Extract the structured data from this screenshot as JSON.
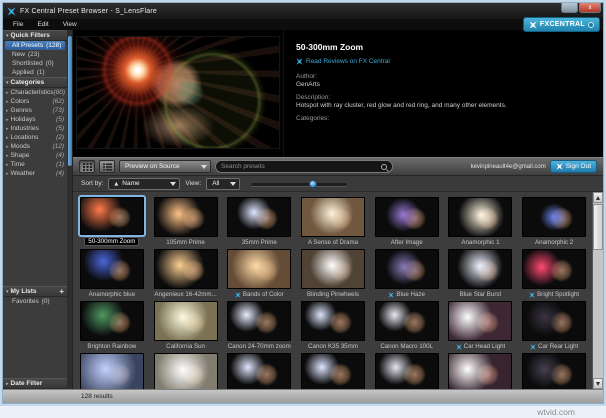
{
  "window": {
    "title": "FX Central Preset Browser - S_LensFlare",
    "menus": [
      "File",
      "Edit",
      "View"
    ]
  },
  "sidebar": {
    "quick_filters": {
      "label": "Quick Filters",
      "items": [
        {
          "label": "All Presets",
          "count": "(128)",
          "selected": true
        },
        {
          "label": "New",
          "count": "(23)"
        },
        {
          "label": "Shortlisted",
          "count": "(0)"
        },
        {
          "label": "Applied",
          "count": "(1)"
        }
      ]
    },
    "categories": {
      "label": "Categories",
      "items": [
        {
          "label": "Characteristics",
          "count": "(80)"
        },
        {
          "label": "Colors",
          "count": "(62)"
        },
        {
          "label": "Genres",
          "count": "(73)"
        },
        {
          "label": "Holidays",
          "count": "(5)"
        },
        {
          "label": "Industries",
          "count": "(5)"
        },
        {
          "label": "Locations",
          "count": "(2)"
        },
        {
          "label": "Moods",
          "count": "(12)"
        },
        {
          "label": "Shape",
          "count": "(4)"
        },
        {
          "label": "Time",
          "count": "(1)"
        },
        {
          "label": "Weather",
          "count": "(4)"
        }
      ]
    },
    "my_lists": {
      "label": "My Lists",
      "add_label": "+",
      "items": [
        {
          "label": "Favorites",
          "count": "(0)"
        }
      ]
    },
    "date_filter": {
      "label": "Date Filter"
    }
  },
  "info_panel": {
    "fx_central_badge": "FXCENTRAL",
    "preset_title": "50-300mm Zoom",
    "review_link": "Read Reviews on FX Central",
    "author_label": "Author:",
    "author": "GenArts",
    "description_label": "Description:",
    "description": "Hotspot with ray cluster, red glow and red ring, and many other elements.",
    "categories_label": "Categories:"
  },
  "toolbar": {
    "preview_dropdown": "Preview on Source",
    "search_placeholder": "Search presets",
    "account_email": "kevinpineault4e@gmail.com",
    "sign_out_label": "Sign Out",
    "sort_by_label": "Sort by:",
    "sort_value": "Name",
    "view_label": "View:",
    "view_value": "All"
  },
  "grid": {
    "presets": [
      {
        "name": "50-300mm Zoom",
        "sel": true,
        "glow": "#ff7a4a",
        "gx": 30,
        "gy": 32,
        "gs": 45,
        "wash": ""
      },
      {
        "name": "105mm Prime",
        "glow": "#ffc387",
        "gx": 38,
        "gy": 42,
        "gs": 50,
        "wash": ""
      },
      {
        "name": "35mm Prime",
        "glow": "#dfe6ff",
        "gx": 42,
        "gy": 38,
        "gs": 40,
        "wash": ""
      },
      {
        "name": "A Sense of Drama",
        "glow": "#fff3dc",
        "gx": 48,
        "gy": 40,
        "gs": 55,
        "wash": "rgba(196,150,104,0.55)"
      },
      {
        "name": "After Image",
        "glow": "#9a7ad6",
        "gx": 44,
        "gy": 44,
        "gs": 42,
        "wash": ""
      },
      {
        "name": "Anamorphic 1",
        "glow": "#fff6e0",
        "gx": 52,
        "gy": 45,
        "gs": 60,
        "wash": ""
      },
      {
        "name": "Anamorphic 2",
        "glow": "#6b85ef",
        "gx": 50,
        "gy": 50,
        "gs": 38,
        "wash": ""
      },
      {
        "name": "Anamorphic blue",
        "glow": "#4a66d8",
        "gx": 36,
        "gy": 30,
        "gs": 42,
        "wash": ""
      },
      {
        "name": "Angenieux 16-42mm...",
        "glow": "#ffd092",
        "gx": 40,
        "gy": 40,
        "gs": 55,
        "wash": ""
      },
      {
        "name": "Bands of Color",
        "badge": true,
        "glow": "#ffdca8",
        "gx": 45,
        "gy": 42,
        "gs": 60,
        "wash": "rgba(190,140,95,0.5)"
      },
      {
        "name": "Blinding Pinwheels",
        "glow": "#ffffff",
        "gx": 48,
        "gy": 40,
        "gs": 55,
        "wash": "rgba(165,135,105,0.45)"
      },
      {
        "name": "Blue Haze",
        "badge": true,
        "glow": "#8a7ab8",
        "gx": 45,
        "gy": 45,
        "gs": 45,
        "wash": ""
      },
      {
        "name": "Blue Star Burst",
        "glow": "#eef2ff",
        "gx": 50,
        "gy": 42,
        "gs": 60,
        "wash": ""
      },
      {
        "name": "Bright Spotlight",
        "badge": true,
        "glow": "#ff4a72",
        "gx": 30,
        "gy": 45,
        "gs": 40,
        "wash": ""
      },
      {
        "name": "Brighton Rainbow",
        "glow": "#4f9a62",
        "gx": 35,
        "gy": 35,
        "gs": 45,
        "wash": ""
      },
      {
        "name": "California Sun",
        "glow": "#fffbe2",
        "gx": 45,
        "gy": 40,
        "gs": 62,
        "wash": "rgba(214,198,140,0.55)"
      },
      {
        "name": "Canon 24-70mm zoom",
        "glow": "#e6ecff",
        "gx": 30,
        "gy": 34,
        "gs": 34,
        "wash": ""
      },
      {
        "name": "Canon K35 35mm",
        "glow": "#dde4fa",
        "gx": 30,
        "gy": 34,
        "gs": 32,
        "wash": ""
      },
      {
        "name": "Canon Macro 100L",
        "glow": "#e9e9f2",
        "gx": 30,
        "gy": 34,
        "gs": 33,
        "wash": ""
      },
      {
        "name": "Car Head Light",
        "badge": true,
        "glow": "#ffffff",
        "gx": 30,
        "gy": 40,
        "gs": 50,
        "wash": "rgba(214,124,170,0.25)"
      },
      {
        "name": "Car Rear Light",
        "badge": true,
        "glow": "#3a3442",
        "gx": 35,
        "gy": 40,
        "gs": 40,
        "wash": ""
      },
      {
        "name": "",
        "glow": "#c3d2ff",
        "gx": 40,
        "gy": 40,
        "gs": 70,
        "wash": "rgba(130,154,220,0.4)"
      },
      {
        "name": "",
        "glow": "#ffffff",
        "gx": 45,
        "gy": 42,
        "gs": 65,
        "wash": "rgba(226,218,192,0.55)"
      },
      {
        "name": "",
        "glow": "#dfe6ff",
        "gx": 32,
        "gy": 35,
        "gs": 36,
        "wash": ""
      },
      {
        "name": "",
        "glow": "#dfe6ff",
        "gx": 32,
        "gy": 35,
        "gs": 36,
        "wash": ""
      },
      {
        "name": "",
        "glow": "#e6e6f0",
        "gx": 32,
        "gy": 35,
        "gs": 36,
        "wash": ""
      },
      {
        "name": "",
        "glow": "#ffffff",
        "gx": 30,
        "gy": 40,
        "gs": 52,
        "wash": "rgba(214,124,170,0.22)"
      },
      {
        "name": "",
        "glow": "#46404e",
        "gx": 35,
        "gy": 40,
        "gs": 40,
        "wash": ""
      }
    ]
  },
  "status_bar": {
    "results": "128 results"
  },
  "watermark": "wtvid.com",
  "colors": {
    "accent": "#35a8d8",
    "selection_blue": "#3a74b4",
    "badge_blue": "#2e9dc8"
  }
}
